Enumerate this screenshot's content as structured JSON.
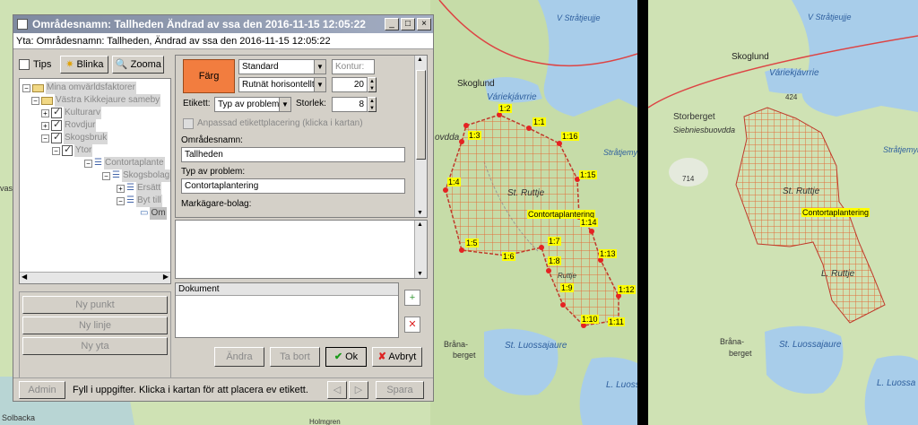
{
  "dialog": {
    "title": "Områdesnamn: Tallheden Ändrad av ssa den 2016-11-15 12:05:22",
    "subtitle": "Yta: Områdesnamn: Tallheden, Ändrad av ssa den 2016-11-15 12:05:22",
    "toolbar": {
      "tips": "Tips",
      "blinka": "Blinka",
      "zooma": "Zooma"
    },
    "tree": [
      {
        "label": "Mina omvärldsfaktorer"
      },
      {
        "label": "Västra Kikkejaure sameby"
      },
      {
        "label": "Kulturarv"
      },
      {
        "label": "Rovdjur"
      },
      {
        "label": "Skogsbruk"
      },
      {
        "label": "Ytor"
      },
      {
        "label": "Contortaplante"
      },
      {
        "label": "Skogsbolag"
      },
      {
        "label": "Ersätt"
      },
      {
        "label": "Byt till"
      },
      {
        "label": "Om"
      }
    ],
    "left_buttons": {
      "ny_punkt": "Ny punkt",
      "ny_linje": "Ny linje",
      "ny_yta": "Ny yta"
    },
    "form": {
      "farg": "Färg",
      "style_select": "Standard",
      "kontur_placeholder": "Kontur:",
      "pattern_select": "Rutnät horisontellt",
      "pattern_size": "20",
      "etikett_label": "Etikett:",
      "etikett_select": "Typ av problem",
      "storlek_label": "Storlek:",
      "storlek_value": "8",
      "custom_label_text": "Anpassad etikettplacering (klicka i kartan)",
      "omradesnamn_label": "Områdesnamn:",
      "omradesnamn_value": "Tallheden",
      "typ_label": "Typ av problem:",
      "typ_value": "Contortaplantering",
      "markagare_label": "Markägare-bolag:"
    },
    "dokument_header": "Dokument",
    "footer": {
      "andra": "Ändra",
      "ta_bort": "Ta bort",
      "ok": "Ok",
      "avbryt": "Avbryt"
    },
    "statusbar": {
      "admin": "Admin",
      "message": "Fyll i uppgifter. Klicka i kartan för att placera ev etikett.",
      "spara": "Spara"
    }
  },
  "map_left": {
    "labels": {
      "skoglund": "Skoglund",
      "vstratjeujje": "V Stråtjeujje",
      "variekjavrrie": "Váriekjávrrie",
      "ovdda": "ovdda",
      "stratjemyrh": "Stråtjemyrh",
      "st_ruttje": "St. Ruttje",
      "ruttje": "Ruttje",
      "vas": "vas",
      "brana": "Bråna-",
      "berget": "berget",
      "st_luossajaure": "St. Luossajaure",
      "l_luossa": "L. Luossa",
      "solbacka": "Solbacka",
      "holmgren": "Holmgren"
    },
    "area_label": "Contortaplantering",
    "vertices": [
      "1:1",
      "1:2",
      "1:3",
      "1:4",
      "1:5",
      "1:6",
      "1:7",
      "1:8",
      "1:9",
      "1:10",
      "1:11",
      "1:12",
      "1:13",
      "1:14",
      "1:15",
      "1:16"
    ]
  },
  "map_right": {
    "labels": {
      "vstratjeujje": "V Stråtjeujje",
      "skoglund": "Skoglund",
      "variekjavrrie": "Váriekjávrrie",
      "h424": "424",
      "storberget": "Storberget",
      "siebniesbuovdda": "Siebniesbuovdda",
      "stratjemyr": "Stråtjemyr",
      "h714": "714",
      "st_ruttje": "St. Ruttje",
      "l_ruttje": "L. Ruttje",
      "brana": "Bråna-",
      "berget": "berget",
      "st_luossajaure": "St. Luossajaure",
      "l_luossa": "L. Luossa"
    },
    "area_label": "Contortaplantering"
  },
  "colors": {
    "fill_area": "#f27d3f",
    "vertex": "#e52222",
    "water": "#a8cdea",
    "forest": "#c9dfae"
  }
}
